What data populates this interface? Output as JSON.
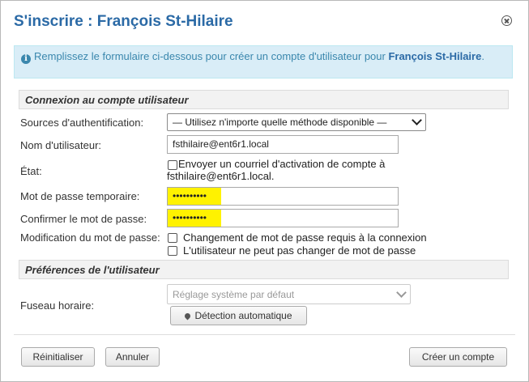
{
  "dialog": {
    "title": "S'inscrire : François St-Hilaire",
    "close_icon": "close-circle-icon"
  },
  "info": {
    "icon": "info-icon",
    "text": "Remplissez le formulaire ci-dessous pour créer un compte d'utilisateur pour ",
    "name": "François St-Hilaire",
    "suffix": "."
  },
  "sections": {
    "account": "Connexion au compte utilisateur",
    "prefs": "Préférences de l'utilisateur"
  },
  "fields": {
    "auth_sources": {
      "label": "Sources d'authentification:",
      "value": "— Utilisez n'importe quelle méthode disponible —"
    },
    "username": {
      "label": "Nom d'utilisateur:",
      "value": "fsthilaire@ent6r1.local"
    },
    "state": {
      "label": "État:",
      "checkbox_text": "Envoyer un courriel d'activation de compte à fsthilaire@ent6r1.local."
    },
    "temp_password": {
      "label": "Mot de passe temporaire:",
      "value": "••••••••••"
    },
    "confirm_password": {
      "label": "Confirmer le mot de passe:",
      "value": "••••••••••"
    },
    "password_change": {
      "label": "Modification du mot de passe:",
      "option1": "Changement de mot de passe requis à la connexion",
      "option2": "L'utilisateur ne peut pas changer de mot de passe"
    },
    "timezone": {
      "label": "Fuseau horaire:",
      "placeholder": "Réglage système par défaut",
      "auto_button": "Détection automatique"
    }
  },
  "footer": {
    "reset": "Réinitialiser",
    "cancel": "Annuler",
    "create": "Créer un compte"
  },
  "colors": {
    "title": "#2b6aa6",
    "info_bg": "#d9edf7",
    "highlight": "#fff200"
  }
}
